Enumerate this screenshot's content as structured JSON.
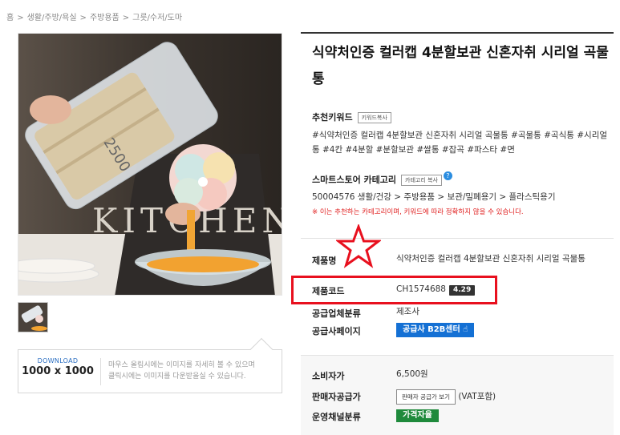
{
  "breadcrumb": [
    "홈",
    "생활/주방/욕실",
    "주방용품",
    "그릇/수저/도마"
  ],
  "breadcrumb_sep": ">",
  "product": {
    "title": "식약처인증 컬러캡 4분할보관 신혼자취 시리얼 곡물통"
  },
  "image": {
    "kitchen_text": "KITCHEN",
    "container_text": "2500"
  },
  "download": {
    "label": "DOWNLOAD",
    "size": "1000 x 1000",
    "desc_line1": "마우스 올림시에는 이미지를 자세히 볼 수 있으며",
    "desc_line2": "클릭시에는 이미지를 다운받을실 수 있습니다."
  },
  "keywords": {
    "label": "추천키워드",
    "copy_button": "키워드복사",
    "text": "#식약처인증 컬러캡 4분할보관 신혼자취 시리얼 곡물통 #곡물통 #곡식통 #시리얼통 #4칸 #4분할 #분할보관 #쌀통 #잡곡 #파스타 #면"
  },
  "category": {
    "label": "스마트스토어 카테고리",
    "copy_button": "카테고리 복사",
    "help": "?",
    "path": "50004576 생활/건강 > 주방용품 > 보관/밀폐용기 > 플라스틱용기",
    "note": "※ 이는 추천하는 카테고리이며, 키워드에 따라 정확하지 않을 수 있습니다."
  },
  "info": {
    "name_label": "제품명",
    "name_value": "식약처인증 컬러캡 4분할보관 신혼자취 시리얼 곡물통",
    "code_label": "제품코드",
    "code_value": "CH1574688",
    "code_badge": "4.29",
    "supplier_type_label": "공급업체분류",
    "supplier_type_value": "제조사",
    "supplier_page_label": "공급사페이지",
    "supplier_page_button": "공급사 B2B센터"
  },
  "price": {
    "consumer_label": "소비자가",
    "consumer_value": "6,500원",
    "seller_label": "판매자공급가",
    "seller_button": "판매자 공급가 보기",
    "seller_note": "(VAT포함)",
    "channel_label": "운영채널분류",
    "channel_badge": "가격자율"
  },
  "colors": {
    "highlight": "#e8101e",
    "b2b": "#1470d4",
    "green": "#1f8a3c",
    "note_red": "#e02020"
  }
}
